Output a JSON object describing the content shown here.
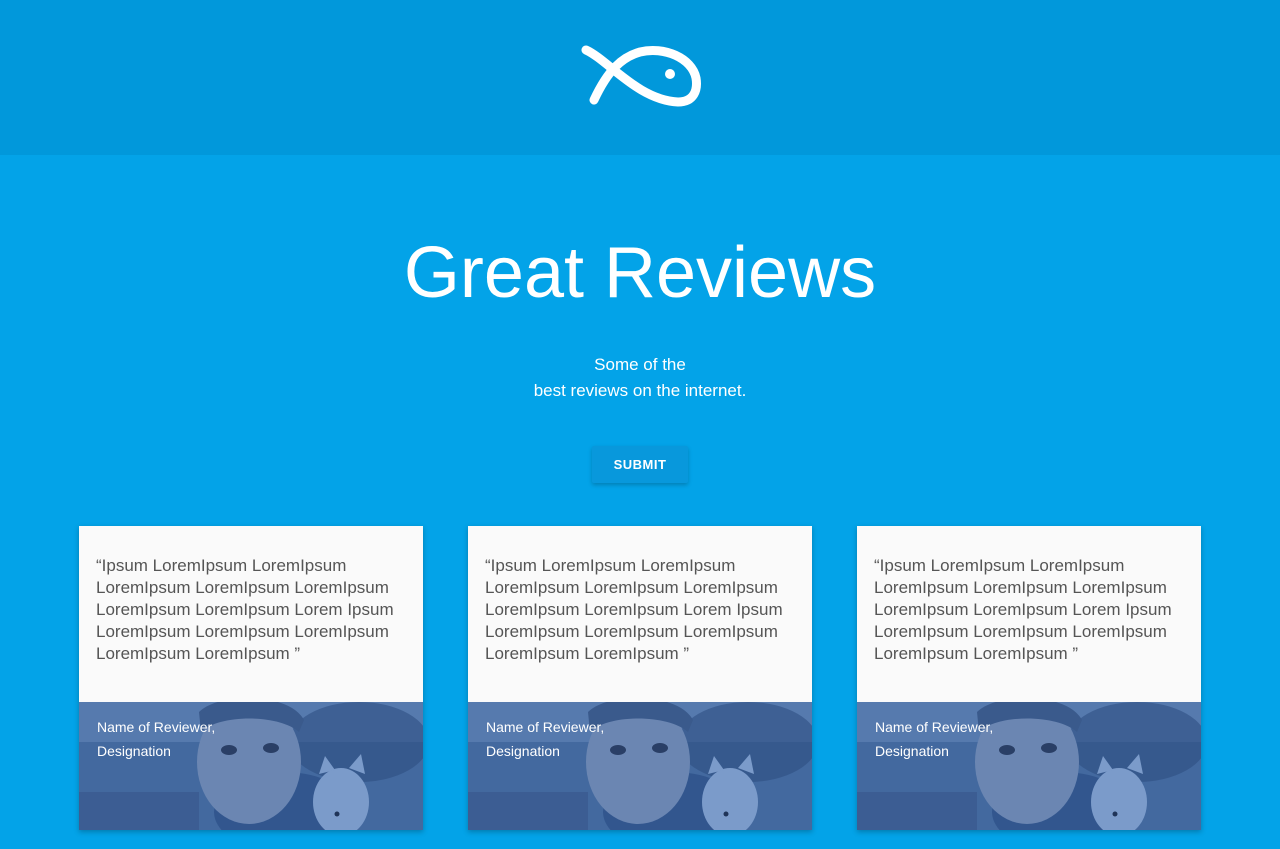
{
  "header": {
    "logo_icon": "fish-logo-icon"
  },
  "hero": {
    "title": "Great Reviews",
    "subtitle_line1": "Some of the",
    "subtitle_line2": "best reviews on the internet.",
    "submit_label": "SUBMIT"
  },
  "reviews": [
    {
      "quote": "“Ipsum LoremIpsum LoremIpsum LoremIpsum LoremIpsum LoremIpsum LoremIpsum LoremIpsum Lorem Ipsum LoremIpsum LoremIpsum LoremIpsum LoremIpsum LoremIpsum ”",
      "reviewer_name": "Name of Reviewer,",
      "reviewer_designation": "Designation"
    },
    {
      "quote": "“Ipsum LoremIpsum LoremIpsum LoremIpsum LoremIpsum LoremIpsum LoremIpsum LoremIpsum Lorem Ipsum LoremIpsum LoremIpsum LoremIpsum LoremIpsum LoremIpsum ”",
      "reviewer_name": "Name of Reviewer,",
      "reviewer_designation": "Designation"
    },
    {
      "quote": "“Ipsum LoremIpsum LoremIpsum LoremIpsum LoremIpsum LoremIpsum LoremIpsum LoremIpsum Lorem Ipsum LoremIpsum LoremIpsum LoremIpsum LoremIpsum LoremIpsum ”",
      "reviewer_name": "Name of Reviewer,",
      "reviewer_designation": "Designation"
    }
  ],
  "colors": {
    "header_bg": "#0198db",
    "page_bg": "#03a3e8",
    "button_bg": "#0898dc",
    "card_bg": "#fafafa",
    "photo_tint": "#3e64a0"
  }
}
